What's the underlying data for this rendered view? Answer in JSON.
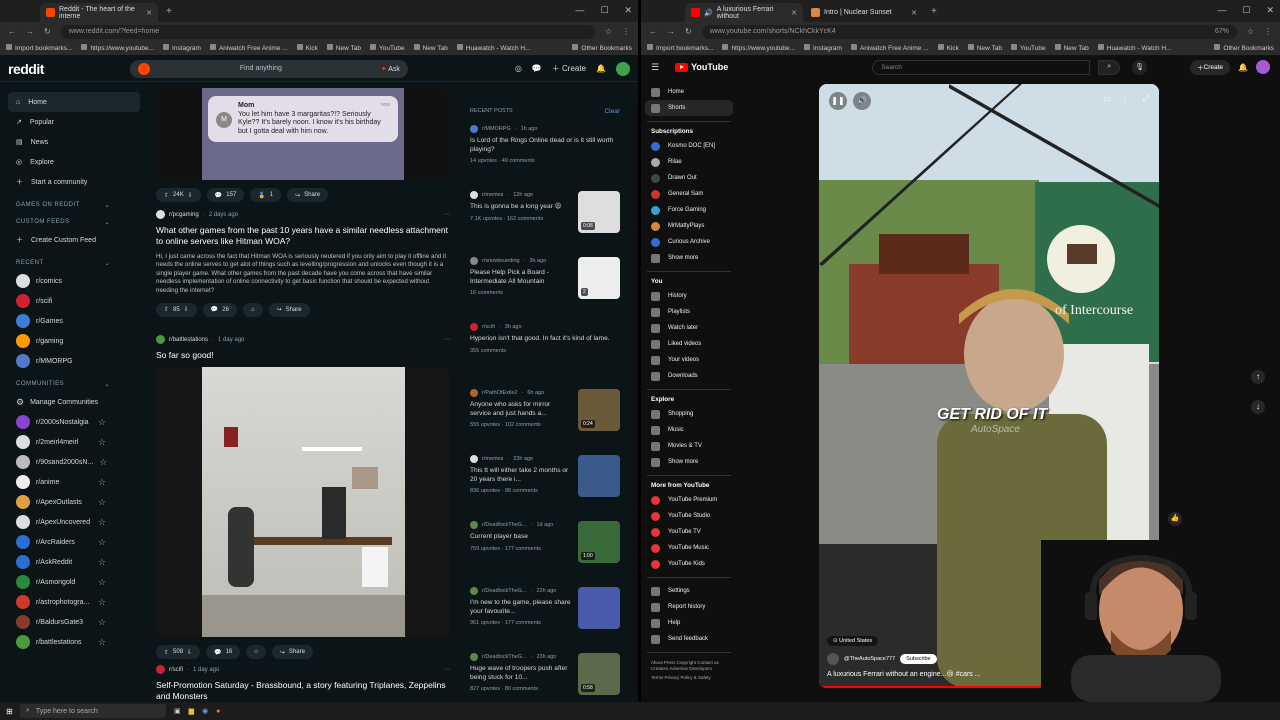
{
  "left_browser": {
    "tab": {
      "title": "Reddit - The heart of the interne"
    },
    "url": "www.reddit.com/?feed=home",
    "bookmarks": [
      "Import bookmarks...",
      "https://www.youtube...",
      "Instagram",
      "Aniwatch Free Anime ...",
      "Kick",
      "New Tab",
      "YouTube",
      "New Tab",
      "Huawatch - Watch H...",
      "Other Bookmarks"
    ]
  },
  "reddit": {
    "logo": "reddit",
    "search_placeholder": "Find anything",
    "ask_label": "Ask",
    "create_label": "Create",
    "nav": [
      {
        "label": "Home",
        "icon": "home-icon"
      },
      {
        "label": "Popular",
        "icon": "popular-icon"
      },
      {
        "label": "News",
        "icon": "news-icon"
      },
      {
        "label": "Explore",
        "icon": "explore-icon"
      },
      {
        "label": "Start a community",
        "icon": "plus-icon"
      }
    ],
    "sections": {
      "games": "GAMES ON REDDIT",
      "custom": "CUSTOM FEEDS",
      "create_feed": "Create Custom Feed",
      "recent": "RECENT",
      "communities": "COMMUNITIES",
      "manage": "Manage Communities"
    },
    "recent_subs": [
      {
        "name": "r/comics",
        "color": "#dddddd"
      },
      {
        "name": "r/scifi",
        "color": "#cc2233"
      },
      {
        "name": "r/Games",
        "color": "#3b7dd8"
      },
      {
        "name": "r/gaming",
        "color": "#ff9900"
      },
      {
        "name": "r/MMORPG",
        "color": "#5577cc"
      }
    ],
    "communities": [
      {
        "name": "r/2000sNostalgia",
        "color": "#8844cc"
      },
      {
        "name": "r/2meirl4meirl",
        "color": "#dddddd"
      },
      {
        "name": "r/90sand2000sN...",
        "color": "#bbbbbb"
      },
      {
        "name": "r/anime",
        "color": "#eeeeee"
      },
      {
        "name": "r/ApexOutlasts",
        "color": "#e0a040"
      },
      {
        "name": "r/ApexUncovered",
        "color": "#dddddd"
      },
      {
        "name": "r/ArcRaiders",
        "color": "#2a6fd1"
      },
      {
        "name": "r/AskReddit",
        "color": "#2a6fd1"
      },
      {
        "name": "r/Asmongold",
        "color": "#2a8a3c"
      },
      {
        "name": "r/astrophotogra...",
        "color": "#d13a2a"
      },
      {
        "name": "r/BaldursGate3",
        "color": "#8a3a2a"
      },
      {
        "name": "r/battlestations",
        "color": "#4a9a3a"
      }
    ],
    "top_card": {
      "sender": "Mom",
      "time": "now",
      "message": "You let him have 3 margaritas?!? Seriously Kyle?? It's barely noon. I know it's his birthday but I gotta deal with him now.",
      "votes": "24K",
      "comments": "157",
      "awards": "1",
      "share": "Share"
    },
    "posts": [
      {
        "sub": "r/pcgaming",
        "time": "2 days ago",
        "title": "What other games from the past 10 years have a similar needless attachment to online servers like Hitman WOA?",
        "body": "Hi, I just came across the fact that Hitman WOA is seriously neutered if you only aim to play it offline and it needs the online serves to get alot of things such as levelling/progression and unlocks even though it is a single player game. What other games from the past decade have you come across that have similar needless implementation of online connectivity to get basic function that should be expected without needing the internet?",
        "votes": "85",
        "comments": "26",
        "share": "Share"
      },
      {
        "sub": "r/battlestations",
        "time": "1 day ago",
        "title": "So far so good!",
        "votes": "508",
        "comments": "16",
        "share": "Share"
      },
      {
        "sub": "r/scifi",
        "time": "1 day ago",
        "title": "Self-Promotion Saturday - Brassbound, a story featuring Triplanes, Zeppelins and Monsters"
      }
    ],
    "recent_posts": {
      "header": "RECENT POSTS",
      "clear": "Clear",
      "items": [
        {
          "sub": "r/MMORPG",
          "time": "1h ago",
          "title": "Is Lord of the Rings Online dead or is it still worth playing?",
          "stats": "14 upvotes · 49 comments",
          "thumb": null
        },
        {
          "sub": "r/memes",
          "time": "12h ago",
          "title": "This is gonna be a long year 😩",
          "stats": "7.1K upvotes · 162 comments",
          "thumb": "#ddd",
          "badge": "0:08"
        },
        {
          "sub": "r/snowboarding",
          "time": "3h ago",
          "title": "Please Help Pick a Board - Intermediate All Mountain",
          "stats": "16 comments",
          "thumb": "#eee",
          "badge": "2"
        },
        {
          "sub": "r/scifi",
          "time": "3h ago",
          "title": "Hyperion isn't that good. In fact it's kind of lame.",
          "stats": "355 comments",
          "thumb": null
        },
        {
          "sub": "r/PathOfExile2",
          "time": "6h ago",
          "title": "Anyone who asks for mirror service and just hands a...",
          "stats": "555 upvotes · 102 comments",
          "thumb": "#6a5a3a",
          "badge": "0:24"
        },
        {
          "sub": "r/memes",
          "time": "23h ago",
          "title": "This tt will either take 2 months or 20 years there i...",
          "stats": "836 upvotes · 98 comments",
          "thumb": "#3a5a8a"
        },
        {
          "sub": "r/DeadlockTheG...",
          "time": "1d ago",
          "title": "Current player base",
          "stats": "759 upvotes · 177 comments",
          "thumb": "#3a6a3a",
          "badge": "1:00"
        },
        {
          "sub": "r/DeadlockTheG...",
          "time": "22h ago",
          "title": "I'm new to the game, please share your favourite...",
          "stats": "961 upvotes · 177 comments",
          "thumb": "#4a5aaa"
        },
        {
          "sub": "r/DeadlockTheG...",
          "time": "23h ago",
          "title": "Huge wave of troopers push after being stuck for 10...",
          "stats": "827 upvotes · 80 comments",
          "thumb": "#5a6a4a",
          "badge": "0:58"
        }
      ]
    }
  },
  "right_browser": {
    "tabs": [
      {
        "title": "A luxurious Ferrari without"
      },
      {
        "title": "Intro | Nuclear Sunset"
      }
    ],
    "url": "www.youtube.com/shorts/NCkhCkkYcK4",
    "zoom": "67%",
    "bookmarks": [
      "Import bookmarks...",
      "https://www.youtube...",
      "Instagram",
      "Aniwatch Free Anime ...",
      "Kick",
      "New Tab",
      "YouTube",
      "New Tab",
      "Huawatch - Watch H...",
      "Other Bookmarks"
    ]
  },
  "youtube": {
    "logo": "YouTube",
    "search_placeholder": "Search",
    "create": "Create",
    "nav": [
      "Home",
      "Shorts"
    ],
    "subscriptions_label": "Subscriptions",
    "subscriptions": [
      {
        "name": "Kosmo DOC [EN]",
        "color": "#3a6ad1"
      },
      {
        "name": "Rilae",
        "color": "#aaaaaa"
      },
      {
        "name": "Drawn Out",
        "color": "#444444"
      },
      {
        "name": "General Sam",
        "color": "#cc3333"
      },
      {
        "name": "Force Gaming",
        "color": "#3aa0d1"
      },
      {
        "name": "MrMattyPlays",
        "color": "#d18a3a"
      },
      {
        "name": "Curious Archive",
        "color": "#3a6ad1"
      }
    ],
    "show_more": "Show more",
    "you_label": "You",
    "you_items": [
      "History",
      "Playlists",
      "Watch later",
      "Liked videos",
      "Your videos",
      "Downloads"
    ],
    "explore_label": "Explore",
    "explore_items": [
      "Shopping",
      "Music",
      "Movies & TV"
    ],
    "more_label": "More from YouTube",
    "more_items": [
      "YouTube Premium",
      "YouTube Studio",
      "YouTube TV",
      "YouTube Music",
      "YouTube Kids"
    ],
    "settings_items": [
      "Settings",
      "Report history",
      "Help",
      "Send feedback"
    ],
    "footer": "About  Press  Copyright  Contact us  Creators  Advertise  Developers",
    "footer2": "Terms  Privacy  Policy & Safety",
    "short": {
      "caption": "GET RID OF IT",
      "watermark": "AutoSpace",
      "sign": "STAGECOACH SHOPS of Intercourse",
      "location": "United States",
      "channel": "@TheAutoSpace777",
      "subscribe": "Subscribe",
      "title": "A luxurious Ferrari without an engine...😢 #cars ..."
    }
  },
  "taskbar": {
    "search_placeholder": "Type here to search"
  }
}
